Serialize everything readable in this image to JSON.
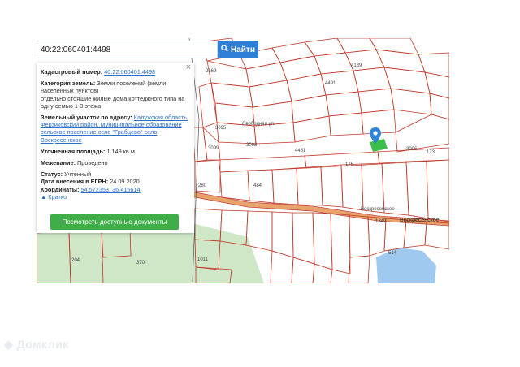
{
  "search": {
    "value": "40:22:060401:4498",
    "button_label": "Найти",
    "button_icon": "search-icon"
  },
  "panel": {
    "close_symbol": "×",
    "cadastral_label": "Кадастровый номер:",
    "cadastral_value": "40:22:060401:4498",
    "category_label": "Категория земель:",
    "category_value": "Земли поселений (земли населенных пунктов)",
    "use_value": "отдельно стоящие жилые дома коттеджного типа на одну семью 1-3 этажа",
    "address_label": "Земельный участок по адресу:",
    "address_value": "Калужская область, Ферзиковский район, Муниципальное образование сельское поселение село \"Грабцево\" село Воскресенское",
    "area_label": "Уточненная площадь:",
    "area_value": "1 149 кв.м.",
    "survey_label": "Межевание:",
    "survey_value": "Проведено",
    "status_label": "Статус:",
    "status_value": "Учтенный",
    "date_label": "Дата внесения в ЕГРН:",
    "date_value": "24.09.2020",
    "coords_label": "Координаты:",
    "coords_value": "54.572353, 36.415614",
    "short_label": "Кратко",
    "docs_button": "Посмотреть доступные документы"
  },
  "map_labels": {
    "street_lower": "Свободная ул.",
    "village": "Воскресенское",
    "village_small": "Воскресенское",
    "parcels": [
      "4189",
      "3098",
      "4451",
      "3096",
      "175",
      "173",
      "204",
      "370",
      "1011",
      "514",
      "280",
      "484",
      "2569",
      "3099",
      "3095",
      "1349",
      "4491"
    ]
  },
  "watermark": "Домклик",
  "colors": {
    "accent": "#2f7fd6",
    "green_button": "#3fae49",
    "parcel_line": "#c0392b",
    "road": "#e8a36a",
    "forest": "#cfe6c7",
    "water": "#9fc9ee",
    "marker": "#2d86d8",
    "selected_parcel": "#3bbf4a"
  }
}
